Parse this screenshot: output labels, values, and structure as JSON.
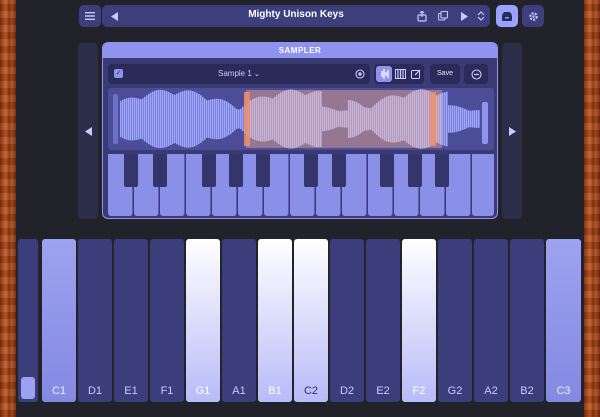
{
  "topbar": {
    "title": "Mighty Unison Keys",
    "menu_icon": "menu-icon",
    "prev_icon": "triangle-left-icon",
    "next_icon": "triangle-right-icon"
  },
  "sampler": {
    "header": "SAMPLER",
    "sample_name": "Sample 1",
    "save_label": "Save"
  },
  "keyboard": {
    "keys": [
      {
        "label": "",
        "style": "stub"
      },
      {
        "label": "C1",
        "style": "mid"
      },
      {
        "label": "D1",
        "style": "dark"
      },
      {
        "label": "E1",
        "style": "dark"
      },
      {
        "label": "F1",
        "style": "dark"
      },
      {
        "label": "G1",
        "style": "light"
      },
      {
        "label": "A1",
        "style": "dark"
      },
      {
        "label": "B1",
        "style": "light"
      },
      {
        "label": "C2",
        "style": "light-inv"
      },
      {
        "label": "D2",
        "style": "dark"
      },
      {
        "label": "E2",
        "style": "dark"
      },
      {
        "label": "F2",
        "style": "light"
      },
      {
        "label": "G2",
        "style": "dark"
      },
      {
        "label": "A2",
        "style": "dark"
      },
      {
        "label": "B2",
        "style": "dark"
      },
      {
        "label": "C3",
        "style": "mid"
      }
    ]
  },
  "colors": {
    "accent": "#8f93f0",
    "panel": "#3a3b74",
    "key_dark": "#3c3d7b",
    "key_light": "#ffffff",
    "loop_region": "#d69a8f"
  }
}
